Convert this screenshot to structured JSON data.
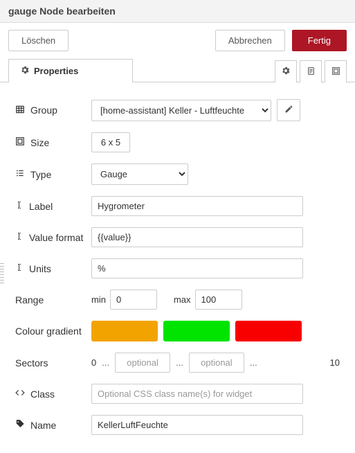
{
  "header": {
    "title": "gauge Node bearbeiten"
  },
  "buttons": {
    "delete": "Löschen",
    "cancel": "Abbrechen",
    "done": "Fertig"
  },
  "tabs": {
    "properties_label": "Properties"
  },
  "form": {
    "group": {
      "label": "Group",
      "selected": "[home-assistant] Keller - Luftfeuchte"
    },
    "size": {
      "label": "Size",
      "value": "6 x 5"
    },
    "type": {
      "label": "Type",
      "selected": "Gauge"
    },
    "label_field": {
      "label": "Label",
      "value": "Hygrometer"
    },
    "value_format": {
      "label": "Value format",
      "value": "{{value}}"
    },
    "units": {
      "label": "Units",
      "value": "%"
    },
    "range": {
      "label": "Range",
      "min_label": "min",
      "min_value": "0",
      "max_label": "max",
      "max_value": "100"
    },
    "colour_gradient": {
      "label": "Colour gradient",
      "c1": "#f2a300",
      "c2": "#00e400",
      "c3": "#f80000"
    },
    "sectors": {
      "label": "Sectors",
      "start": "0",
      "opt1_placeholder": "optional",
      "opt2_placeholder": "optional",
      "end": "10",
      "dots": "..."
    },
    "class": {
      "label": "Class",
      "placeholder": "Optional CSS class name(s) for widget",
      "value": ""
    },
    "name": {
      "label": "Name",
      "value": "KellerLuftFeuchte"
    }
  }
}
